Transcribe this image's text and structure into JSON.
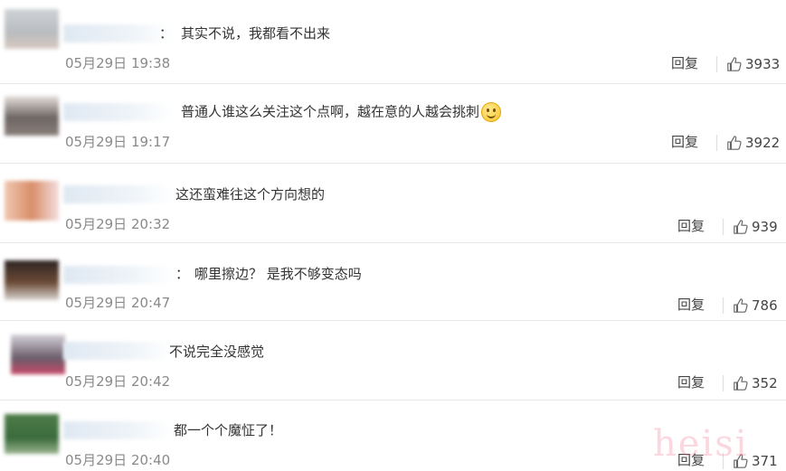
{
  "comments": [
    {
      "sep": "：",
      "text": "其实不说，我都看不出来",
      "time": "05月29日 19:38",
      "reply": "回复",
      "likes": "3933",
      "emoji": false
    },
    {
      "sep": "",
      "text": "普通人谁这么关注这个点啊，越在意的人越会挑刺",
      "time": "05月29日 19:17",
      "reply": "回复",
      "likes": "3922",
      "emoji": true
    },
    {
      "sep": "",
      "text": "这还蛮难往这个方向想的",
      "time": "05月29日 20:32",
      "reply": "回复",
      "likes": "939",
      "emoji": false
    },
    {
      "sep": "：",
      "text": "哪里擦边？ 是我不够变态吗",
      "time": "05月29日 20:47",
      "reply": "回复",
      "likes": "786",
      "emoji": false
    },
    {
      "sep": "",
      "text": "不说完全没感觉",
      "time": "05月29日 20:42",
      "reply": "回复",
      "likes": "352",
      "emoji": false
    },
    {
      "sep": "",
      "text": "都一个个魔怔了！",
      "time": "05月29日 20:40",
      "reply": "回复",
      "likes": "371",
      "emoji": false
    }
  ],
  "watermark": "heisi",
  "icons": {
    "like": "thumbs-up-icon",
    "emoji": "smile-emoji-icon"
  },
  "colors": {
    "time": "#8a8a8a",
    "divider": "#e6e6e6",
    "nickname_blur": "#dfe8f2"
  }
}
